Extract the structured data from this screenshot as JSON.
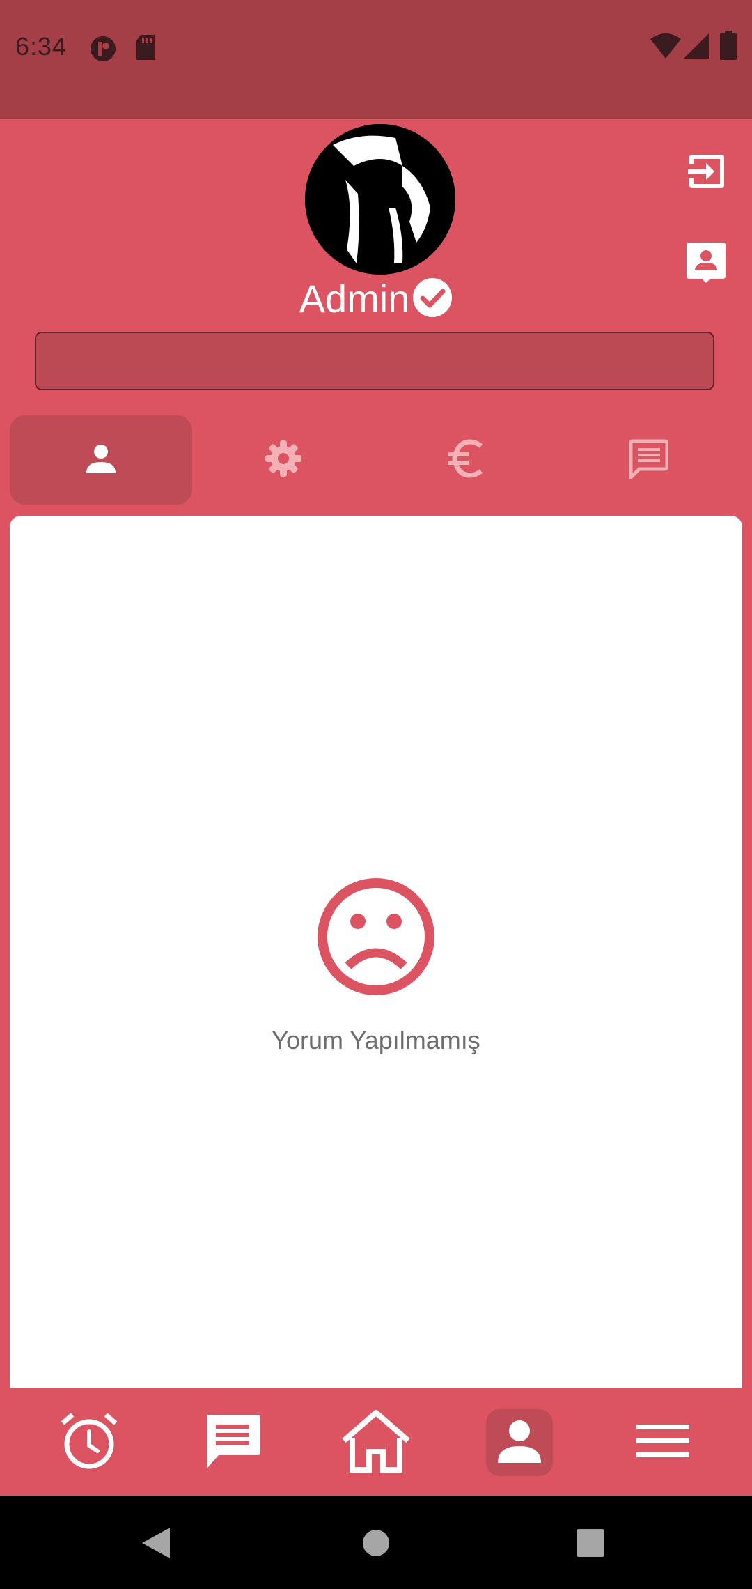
{
  "status_bar": {
    "time": "6:34",
    "icons": [
      "app-notification-icon",
      "sd-card-icon",
      "wifi-icon",
      "signal-icon",
      "battery-icon"
    ]
  },
  "profile": {
    "username": "Admin",
    "verified": true,
    "bio_text": ""
  },
  "top_actions": [
    "logout-icon",
    "contact-card-icon"
  ],
  "tabs": [
    {
      "icon": "person-icon",
      "active": true
    },
    {
      "icon": "settings-icon",
      "active": false
    },
    {
      "icon": "euro-icon",
      "active": false
    },
    {
      "icon": "message-icon",
      "active": false
    }
  ],
  "content": {
    "empty_icon": "sad-face-icon",
    "empty_text": "Yorum Yapılmamış"
  },
  "bottom_nav": [
    {
      "icon": "alarm-icon",
      "active": false
    },
    {
      "icon": "chat-icon",
      "active": false
    },
    {
      "icon": "home-icon",
      "active": false
    },
    {
      "icon": "profile-icon",
      "active": true
    },
    {
      "icon": "menu-icon",
      "active": false
    }
  ],
  "system_nav": [
    "back-icon",
    "home-circle-icon",
    "recents-icon"
  ],
  "colors": {
    "primary": "#dc5361",
    "status_bar": "#a43e47",
    "active_tab": "#be4b56",
    "card": "#ffffff",
    "text_muted": "#6d6d6d"
  }
}
